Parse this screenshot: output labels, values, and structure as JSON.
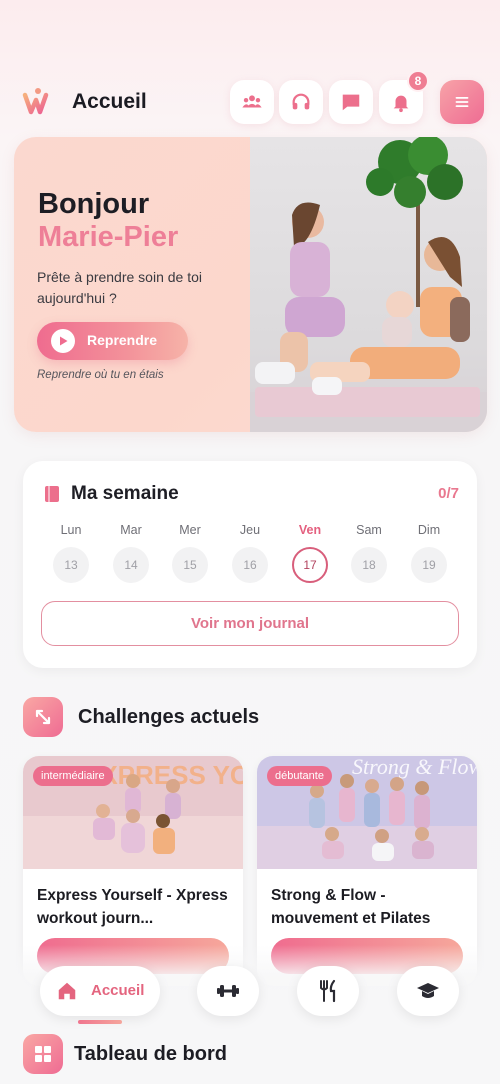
{
  "header": {
    "title": "Accueil",
    "notification_count": "8",
    "icons": [
      "community-icon",
      "headphones-icon",
      "chat-icon",
      "bell-icon",
      "menu-icon"
    ]
  },
  "hero": {
    "greeting": "Bonjour",
    "name": "Marie-Pier",
    "subtitle": "Prête à prendre soin de toi aujourd'hui ?",
    "resume_label": "Reprendre",
    "note": "Reprendre où tu en étais"
  },
  "week": {
    "title": "Ma semaine",
    "count": "0/7",
    "days": [
      {
        "name": "Lun",
        "num": "13"
      },
      {
        "name": "Mar",
        "num": "14"
      },
      {
        "name": "Mer",
        "num": "15"
      },
      {
        "name": "Jeu",
        "num": "16"
      },
      {
        "name": "Ven",
        "num": "17"
      },
      {
        "name": "Sam",
        "num": "18"
      },
      {
        "name": "Dim",
        "num": "19"
      }
    ],
    "journal_label": "Voir mon journal"
  },
  "challenges": {
    "title": "Challenges actuels",
    "items": [
      {
        "tag": "intermédiaire",
        "title": "Express Yourself - Xpress workout journ...",
        "banner": "EXPRESS YOURSELF"
      },
      {
        "tag": "débutante",
        "title": "Strong & Flow - mouvement et Pilates",
        "banner": "Strong & Flow"
      }
    ]
  },
  "dashboard": {
    "title": "Tableau de bord"
  },
  "nav": {
    "home_label": "Accueil"
  },
  "colors": {
    "accent": "#ee7f97",
    "accent_dark": "#e4657f",
    "hero_bg": "#fbd8cf"
  }
}
